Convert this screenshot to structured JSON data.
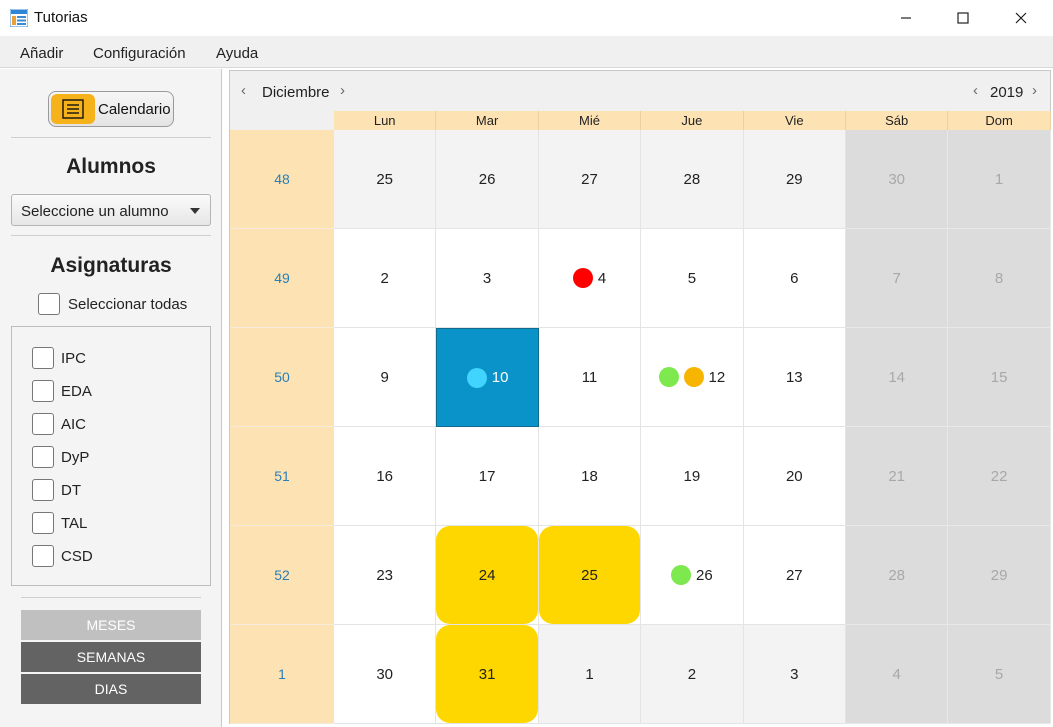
{
  "window": {
    "title": "Tutorias",
    "controls": [
      "minimize",
      "maximize",
      "close"
    ]
  },
  "menu": [
    "Añadir",
    "Configuración",
    "Ayuda"
  ],
  "sidebar": {
    "calendar_toggle": "Calendario",
    "students_title": "Alumnos",
    "student_select": "Seleccione un alumno",
    "subjects_title": "Asignaturas",
    "select_all": "Seleccionar todas",
    "subjects": [
      "IPC",
      "EDA",
      "AIC",
      "DyP",
      "DT",
      "TAL",
      "CSD"
    ],
    "view_buttons": [
      {
        "label": "MESES",
        "color": "#c0c0c0"
      },
      {
        "label": "SEMANAS",
        "color": "#636363"
      },
      {
        "label": "DIAS",
        "color": "#636363"
      }
    ]
  },
  "calendar": {
    "month": "Diciembre",
    "year": "2019",
    "weekdays": [
      "Lun",
      "Mar",
      "Mié",
      "Jue",
      "Vie",
      "Sáb",
      "Dom"
    ],
    "weeks": [
      {
        "week": "48",
        "days": [
          {
            "day": "25",
            "state": "outmonth"
          },
          {
            "day": "26",
            "state": "outmonth"
          },
          {
            "day": "27",
            "state": "outmonth"
          },
          {
            "day": "28",
            "state": "outmonth"
          },
          {
            "day": "29",
            "state": "outmonth"
          },
          {
            "day": "30",
            "state": "weekend"
          },
          {
            "day": "1",
            "state": "weekend"
          }
        ]
      },
      {
        "week": "49",
        "days": [
          {
            "day": "2",
            "state": "inmonth"
          },
          {
            "day": "3",
            "state": "inmonth"
          },
          {
            "day": "4",
            "state": "inmonth",
            "dots": [
              "#ff0000"
            ]
          },
          {
            "day": "5",
            "state": "inmonth"
          },
          {
            "day": "6",
            "state": "inmonth"
          },
          {
            "day": "7",
            "state": "weekend"
          },
          {
            "day": "8",
            "state": "weekend"
          }
        ]
      },
      {
        "week": "50",
        "days": [
          {
            "day": "9",
            "state": "inmonth"
          },
          {
            "day": "10",
            "state": "selected",
            "dots": [
              "#40d4ff"
            ]
          },
          {
            "day": "11",
            "state": "inmonth"
          },
          {
            "day": "12",
            "state": "inmonth",
            "dots": [
              "#7ee84f",
              "#f7b500"
            ]
          },
          {
            "day": "13",
            "state": "inmonth"
          },
          {
            "day": "14",
            "state": "weekend"
          },
          {
            "day": "15",
            "state": "weekend"
          }
        ]
      },
      {
        "week": "51",
        "days": [
          {
            "day": "16",
            "state": "inmonth"
          },
          {
            "day": "17",
            "state": "inmonth"
          },
          {
            "day": "18",
            "state": "inmonth"
          },
          {
            "day": "19",
            "state": "inmonth"
          },
          {
            "day": "20",
            "state": "inmonth"
          },
          {
            "day": "21",
            "state": "weekend"
          },
          {
            "day": "22",
            "state": "weekend"
          }
        ]
      },
      {
        "week": "52",
        "days": [
          {
            "day": "23",
            "state": "inmonth"
          },
          {
            "day": "24",
            "state": "inmonth",
            "holiday": true
          },
          {
            "day": "25",
            "state": "inmonth",
            "holiday": true
          },
          {
            "day": "26",
            "state": "inmonth",
            "dots": [
              "#7ee84f"
            ]
          },
          {
            "day": "27",
            "state": "inmonth"
          },
          {
            "day": "28",
            "state": "weekend"
          },
          {
            "day": "29",
            "state": "weekend"
          }
        ]
      },
      {
        "week": "1",
        "days": [
          {
            "day": "30",
            "state": "inmonth"
          },
          {
            "day": "31",
            "state": "inmonth",
            "holiday": true
          },
          {
            "day": "1",
            "state": "outmonth"
          },
          {
            "day": "2",
            "state": "outmonth"
          },
          {
            "day": "3",
            "state": "outmonth"
          },
          {
            "day": "4",
            "state": "weekend"
          },
          {
            "day": "5",
            "state": "weekend"
          }
        ]
      }
    ]
  }
}
